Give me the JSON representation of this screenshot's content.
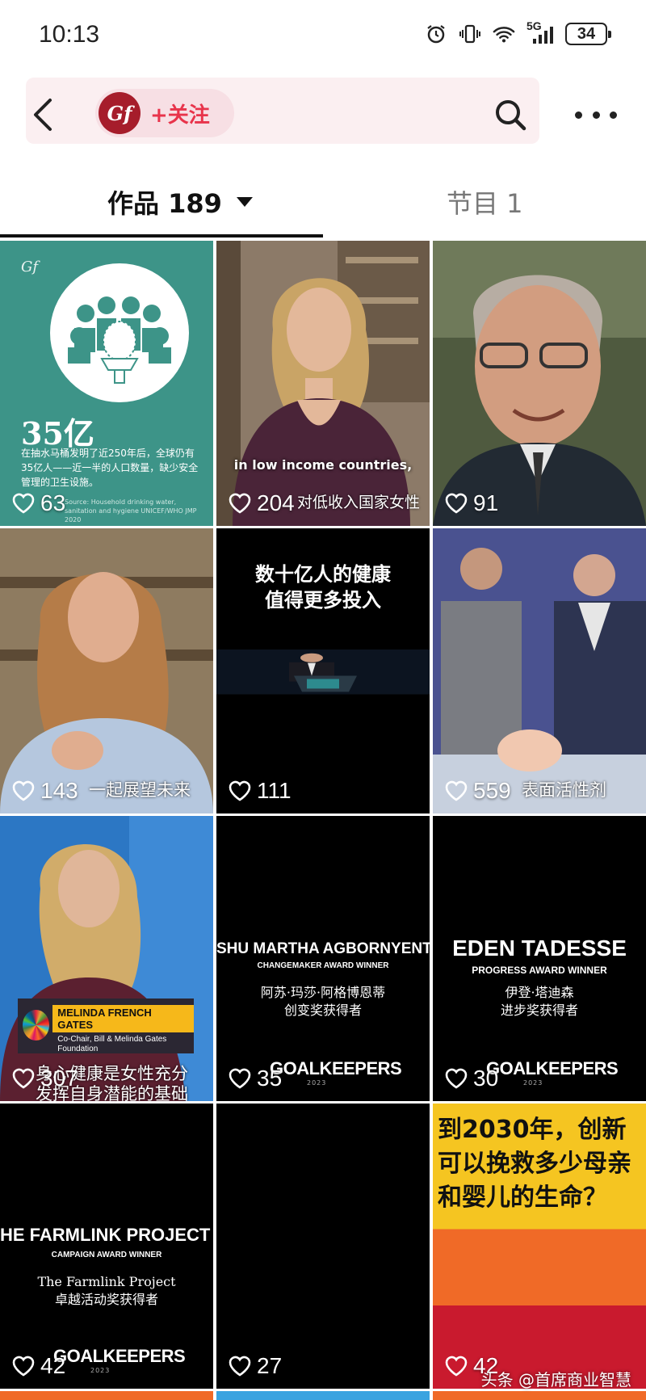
{
  "status_bar": {
    "time": "10:13",
    "network": "5G",
    "battery": "34"
  },
  "header": {
    "avatar_text": "Gf",
    "follow_label": "+关注"
  },
  "tabs": {
    "works": "作品 189",
    "programs": "节目 1"
  },
  "tiles": [
    {
      "likes": "63",
      "big_number": "35亿",
      "body": "在抽水马桶发明了近250年后，全球仍有35亿人——近一半的人口数量，缺少安全管理的卫生设施。",
      "footnote": "Source: Household drinking water, sanitation and hygiene UNICEF/WHO JMP 2020"
    },
    {
      "likes": "204",
      "subtitle_en": "in low income countries,",
      "subtitle_cn": "对低收入国家女性"
    },
    {
      "likes": "91"
    },
    {
      "likes": "143",
      "subtitle_cn": "一起展望未来"
    },
    {
      "likes": "111",
      "headline_line1": "数十亿人的健康",
      "headline_line2": "值得更多投入"
    },
    {
      "likes": "559",
      "subtitle_cn": "表面活性剂"
    },
    {
      "likes": "307",
      "badge_name": "MELINDA FRENCH GATES",
      "badge_role": "Co-Chair, Bill & Melinda Gates Foundation",
      "subtitle_line1": "身心健康是女性充分",
      "subtitle_line2": "发挥自身潜能的基础"
    },
    {
      "likes": "35",
      "award_name": "SHU MARTHA AGBORNYENT",
      "award_role": "CHANGEMAKER AWARD WINNER",
      "award_cn_line1": "阿苏·玛莎·阿格博恩蒂",
      "award_cn_line2": "创变奖获得者",
      "logo": "GOALKEEPERS",
      "logo_year": "2023"
    },
    {
      "likes": "30",
      "award_name": "EDEN TADESSE",
      "award_role": "PROGRESS AWARD WINNER",
      "award_cn_line1": "伊登·塔迪森",
      "award_cn_line2": "进步奖获得者",
      "logo": "GOALKEEPERS",
      "logo_year": "2023"
    },
    {
      "likes": "42",
      "award_name": "HE FARMLINK PROJECT",
      "award_role": "CAMPAIGN AWARD WINNER",
      "award_cn_line1": "The Farmlink Project",
      "award_cn_line2": "卓越活动奖获得者",
      "logo": "GOALKEEPERS",
      "logo_year": "2023"
    },
    {
      "likes": "27"
    },
    {
      "likes": "42",
      "line1": "到2030年，创新",
      "line2": "可以挽救多少母亲",
      "line3": "和婴儿的生命？"
    }
  ],
  "watermark": "头条 @首席商业智慧",
  "icons": [
    "back-arrow-icon",
    "search-icon",
    "more-icon",
    "heart-icon",
    "alarm-icon",
    "vibrate-icon",
    "wifi-icon",
    "signal-icon",
    "battery-icon"
  ]
}
